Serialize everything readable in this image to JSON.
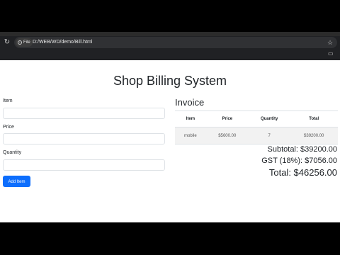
{
  "browser": {
    "chip_label": "File",
    "url": "D:/WEB/WD/demo/Bill.html"
  },
  "app": {
    "title": "Shop Billing System"
  },
  "form": {
    "item_label": "Item",
    "price_label": "Price",
    "quantity_label": "Quantity",
    "item_value": "",
    "price_value": "",
    "quantity_value": "",
    "add_button": "Add Item"
  },
  "invoice": {
    "title": "Invoice",
    "headers": [
      "Item",
      "Price",
      "Quantity",
      "Total"
    ],
    "rows": [
      [
        "mobile",
        "$5600.00",
        "7",
        "$39200.00"
      ]
    ],
    "subtotal": "Subtotal: $39200.00",
    "gst": "GST (18%): $7056.00",
    "total": "Total: $46256.00"
  },
  "colors": {
    "accent": "#0d6efd",
    "chrome": "#202124"
  }
}
